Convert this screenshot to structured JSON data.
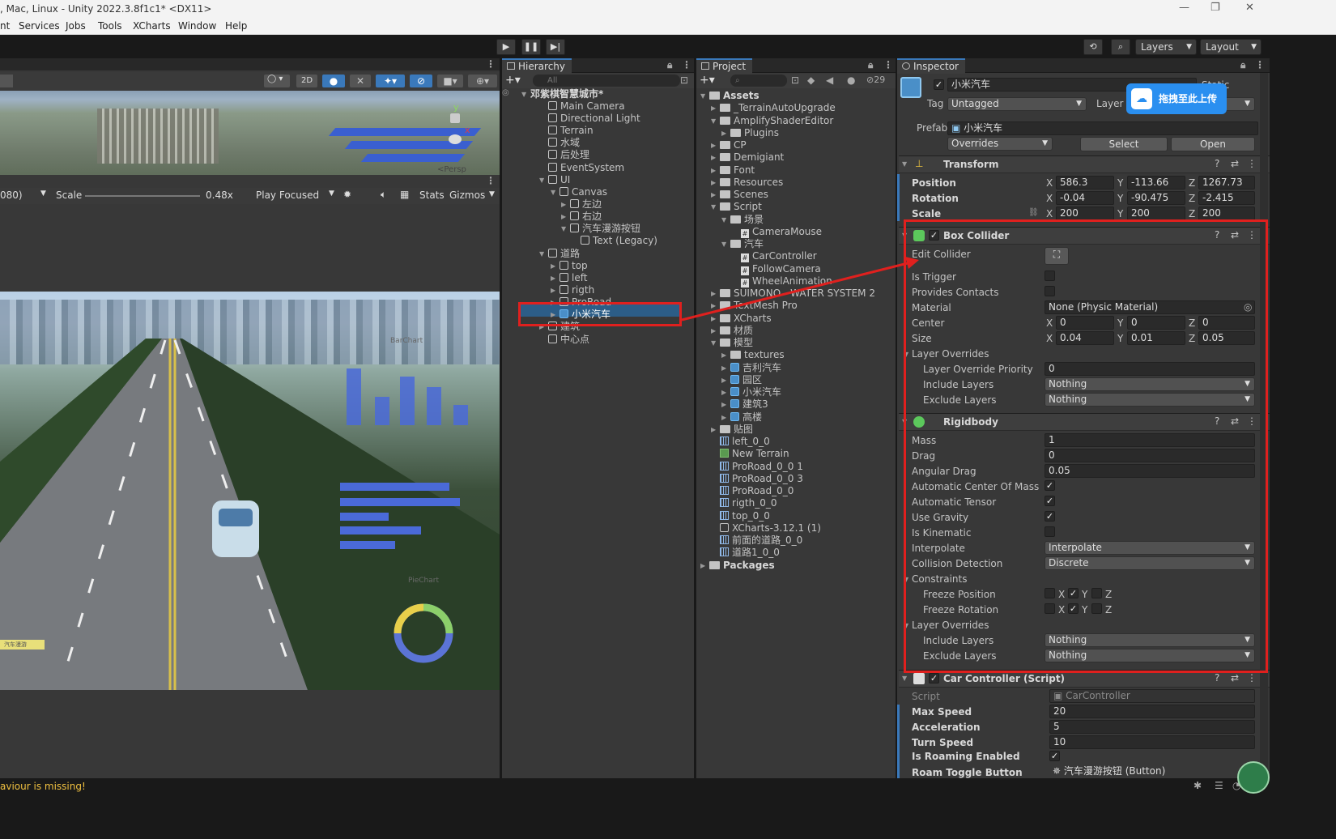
{
  "window": {
    "title": ", Mac, Linux - Unity 2022.3.8f1c1* <DX11>"
  },
  "menu": [
    "nt",
    "Services",
    "Jobs",
    "Tools",
    "XCharts",
    "Window",
    "Help"
  ],
  "toolbar": {
    "layers": "Layers",
    "layout": "Layout"
  },
  "scene": {
    "mode_2d": "2D",
    "persp": "<Persp",
    "resolution": "080)",
    "scale_label": "Scale",
    "scale_value": "0.48x",
    "play_focused": "Play Focused",
    "stats": "Stats",
    "gizmos": "Gizmos",
    "barchart_label": "BarChart",
    "piechart_label": "PieChart",
    "roam_button": "汽车漫游"
  },
  "hierarchy": {
    "tab": "Hierarchy",
    "search_placeholder": "All",
    "items": [
      "邓紫棋智慧城市*",
      "Main Camera",
      "Directional Light",
      "Terrain",
      "水域",
      "后处理",
      "EventSystem",
      "UI",
      "Canvas",
      "左边",
      "右边",
      "汽车漫游按钮",
      "Text (Legacy)",
      "道路",
      "top",
      "left",
      "rigth",
      "ProRoad",
      "小米汽车",
      "建筑",
      "中心点"
    ]
  },
  "project": {
    "tab": "Project",
    "hidden_count": "29",
    "items": [
      "Assets",
      "_TerrainAutoUpgrade",
      "AmplifyShaderEditor",
      "Plugins",
      "CP",
      "Demigiant",
      "Font",
      "Resources",
      "Scenes",
      "Script",
      "场景",
      "CameraMouse",
      "汽车",
      "CarController",
      "FollowCamera",
      "WheelAnimation",
      "SUIMONO - WATER SYSTEM 2",
      "TextMesh Pro",
      "XCharts",
      "材质",
      "模型",
      "textures",
      "吉利汽车",
      "园区",
      "小米汽车",
      "建筑3",
      "高楼",
      "贴图",
      "left_0_0",
      "New Terrain",
      "ProRoad_0_0 1",
      "ProRoad_0_0 3",
      "ProRoad_0_0",
      "rigth_0_0",
      "top_0_0",
      "XCharts-3.12.1 (1)",
      "前面的道路_0_0",
      "道路1_0_0",
      "Packages"
    ]
  },
  "inspector": {
    "tab": "Inspector",
    "object_name": "小米汽车",
    "static_label": "Static",
    "tag_label": "Tag",
    "tag_value": "Untagged",
    "layer_label": "Layer",
    "prefab_label": "Prefab",
    "prefab_value": "小米汽车",
    "overrides": "Overrides",
    "select": "Select",
    "open": "Open",
    "upload_badge": "拖拽至此上传",
    "transform": {
      "title": "Transform",
      "position_label": "Position",
      "position": {
        "x": "586.3",
        "y": "-113.66",
        "z": "1267.73"
      },
      "rotation_label": "Rotation",
      "rotation": {
        "x": "-0.04",
        "y": "-90.475",
        "z": "-2.415"
      },
      "scale_label": "Scale",
      "scale": {
        "x": "200",
        "y": "200",
        "z": "200"
      }
    },
    "box_collider": {
      "title": "Box Collider",
      "edit_collider": "Edit Collider",
      "is_trigger": "Is Trigger",
      "provides_contacts": "Provides Contacts",
      "material_label": "Material",
      "material_value": "None (Physic Material)",
      "center_label": "Center",
      "center": {
        "x": "0",
        "y": "0",
        "z": "0"
      },
      "size_label": "Size",
      "size": {
        "x": "0.04",
        "y": "0.01",
        "z": "0.05"
      },
      "layer_overrides": "Layer Overrides",
      "priority_label": "Layer Override Priority",
      "priority_value": "0",
      "include_label": "Include Layers",
      "include_value": "Nothing",
      "exclude_label": "Exclude Layers",
      "exclude_value": "Nothing"
    },
    "rigidbody": {
      "title": "Rigidbody",
      "mass_label": "Mass",
      "mass": "1",
      "drag_label": "Drag",
      "drag": "0",
      "angular_drag_label": "Angular Drag",
      "angular_drag": "0.05",
      "auto_com": "Automatic Center Of Mass",
      "auto_tensor": "Automatic Tensor",
      "use_gravity": "Use Gravity",
      "is_kinematic": "Is Kinematic",
      "interpolate_label": "Interpolate",
      "interpolate": "Interpolate",
      "collision_label": "Collision Detection",
      "collision": "Discrete",
      "constraints": "Constraints",
      "freeze_position": "Freeze Position",
      "freeze_rotation": "Freeze Rotation",
      "axis_x": "X",
      "axis_y": "Y",
      "axis_z": "Z",
      "layer_overrides": "Layer Overrides",
      "include_label": "Include Layers",
      "include_value": "Nothing",
      "exclude_label": "Exclude Layers",
      "exclude_value": "Nothing"
    },
    "car_controller": {
      "title": "Car Controller (Script)",
      "script_label": "Script",
      "script_value": "CarController",
      "max_speed_label": "Max Speed",
      "max_speed": "20",
      "accel_label": "Acceleration",
      "accel": "5",
      "turn_label": "Turn Speed",
      "turn": "10",
      "roaming_label": "Is Roaming Enabled",
      "roam_btn_label": "Roam Toggle Button",
      "roam_btn_value": "汽车漫游按钮 (Button)"
    }
  },
  "console": {
    "message": "aviour is missing!"
  },
  "colors": {
    "accent": "#3a79bb",
    "highlight": "#e0201e",
    "warning": "#f0c040"
  }
}
